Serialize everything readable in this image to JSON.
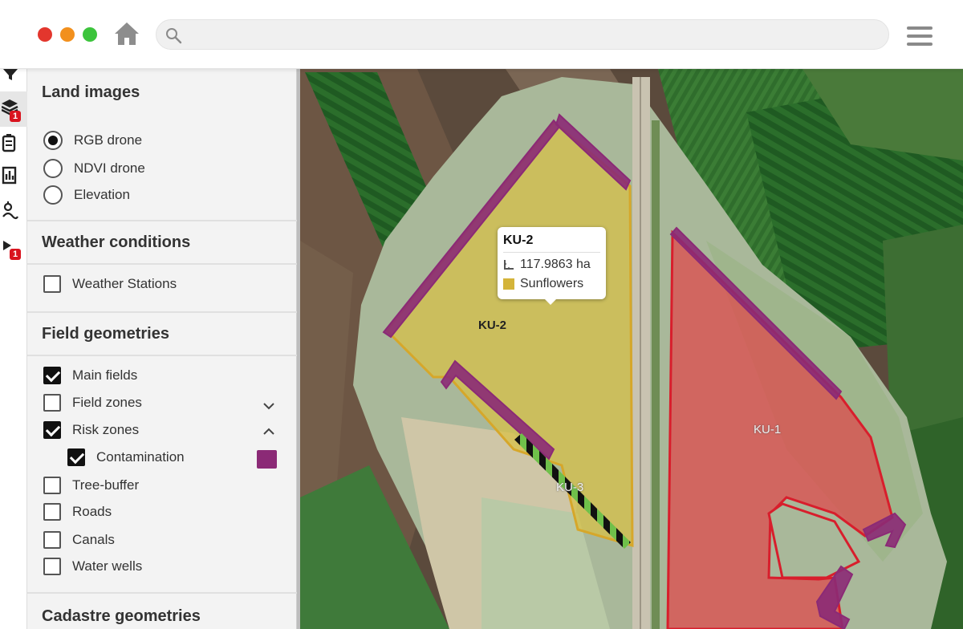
{
  "browser": {
    "url": ""
  },
  "rail": {
    "layers_badge": "1",
    "tools_badge": "1"
  },
  "panel": {
    "land_images": {
      "title": "Land images",
      "options": [
        "RGB drone",
        "NDVI drone",
        "Elevation"
      ],
      "selected": "RGB drone"
    },
    "weather": {
      "title": "Weather conditions",
      "items": [
        {
          "label": "Weather Stations",
          "checked": false
        }
      ]
    },
    "field_geometries": {
      "title": "Field geometries",
      "items": [
        {
          "label": "Main fields",
          "checked": true
        },
        {
          "label": "Field zones",
          "checked": false,
          "expand": "down"
        },
        {
          "label": "Risk zones",
          "checked": true,
          "expand": "up"
        },
        {
          "label": "Contamination",
          "checked": true,
          "color": "#8b2a76"
        },
        {
          "label": "Tree-buffer",
          "checked": false
        },
        {
          "label": "Roads",
          "checked": false
        },
        {
          "label": "Canals",
          "checked": false
        },
        {
          "label": "Water wells",
          "checked": false
        }
      ]
    },
    "cadastre": {
      "title": "Cadastre geometries"
    }
  },
  "map": {
    "popup": {
      "title": "KU-2",
      "area": "117.9863 ha",
      "crop": "Sunflowers",
      "crop_color": "#d4b43a"
    },
    "fields": [
      {
        "name": "KU-2",
        "color": "#d8c045"
      },
      {
        "name": "KU-1",
        "color": "#e0464a"
      },
      {
        "name": "KU-3",
        "color": "#60a840"
      }
    ],
    "colors": {
      "risk": "#8b2a76",
      "ku2_fill": "#d8c045",
      "ku1_fill": "#e0464a"
    }
  }
}
